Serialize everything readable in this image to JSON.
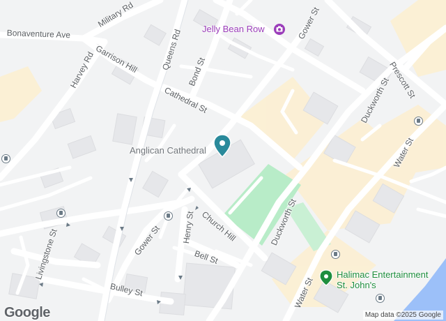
{
  "streets": {
    "military_rd": "Military Rd",
    "bonaventure_ave": "Bonaventure Ave",
    "harvey_rd": "Harvey Rd",
    "garrison_hill": "Garrison Hill",
    "queens_rd": "Queens Rd",
    "bond_st": "Bond St",
    "cathedral_st": "Cathedral St",
    "gower_st_north": "Gower St",
    "gower_st_south": "Gower St",
    "prescott_st": "Prescott St",
    "duckworth_st_north": "Duckworth St",
    "duckworth_st_south": "Duckworth St",
    "water_st_east": "Water St",
    "water_st_south": "Water St",
    "church_hill": "Church Hill",
    "henry_st": "Henry St",
    "bell_st": "Bell St",
    "livingstone_st": "Livingstone St",
    "bulley_st": "Bulley St"
  },
  "pois": {
    "jelly_bean_row": {
      "label": "Jelly Bean Row",
      "icon": "camera-icon",
      "color": "#9b3dba"
    },
    "anglican_cathedral": {
      "label": "Anglican Cathedral",
      "icon": "place-marker-icon",
      "color": "#2a8a9b"
    },
    "halimac": {
      "label_line1": "Halimac Entertainment",
      "label_line2": "St. John's",
      "icon": "park-marker-icon",
      "color": "#1e8e3e"
    }
  },
  "transit": {
    "icon": "bus-stop-icon"
  },
  "branding": {
    "logo": "Google"
  },
  "attribution": "Map data ©2025 Google",
  "colors": {
    "park": "#b8ecc8",
    "water": "#9cc0f9",
    "road": "#ffffff",
    "land": "#f2f3f4",
    "commercial": "#fcefd2"
  }
}
